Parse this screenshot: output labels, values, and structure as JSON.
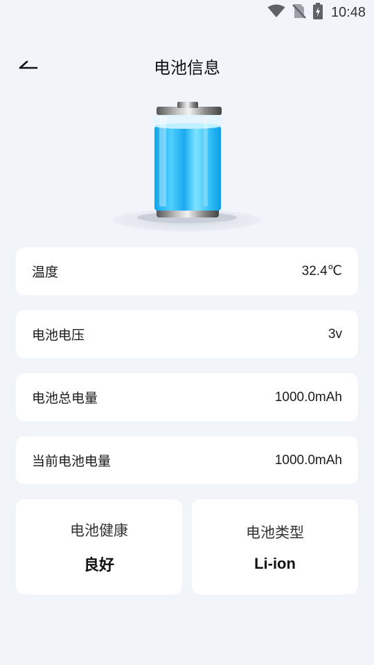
{
  "status_bar": {
    "time": "10:48",
    "icons": [
      "wifi-icon",
      "no-sim-icon",
      "battery-charging-icon"
    ]
  },
  "header": {
    "back_icon": "back-arrow-icon",
    "title": "电池信息"
  },
  "battery_image": {
    "fill_color": "#19b6f5"
  },
  "info_rows": [
    {
      "label": "温度",
      "value": "32.4℃"
    },
    {
      "label": "电池电压",
      "value": "3v"
    },
    {
      "label": "电池总电量",
      "value": "1000.0mAh"
    },
    {
      "label": "当前电池电量",
      "value": "1000.0mAh"
    }
  ],
  "tiles": [
    {
      "label": "电池健康",
      "value": "良好"
    },
    {
      "label": "电池类型",
      "value": "Li-ion"
    }
  ]
}
